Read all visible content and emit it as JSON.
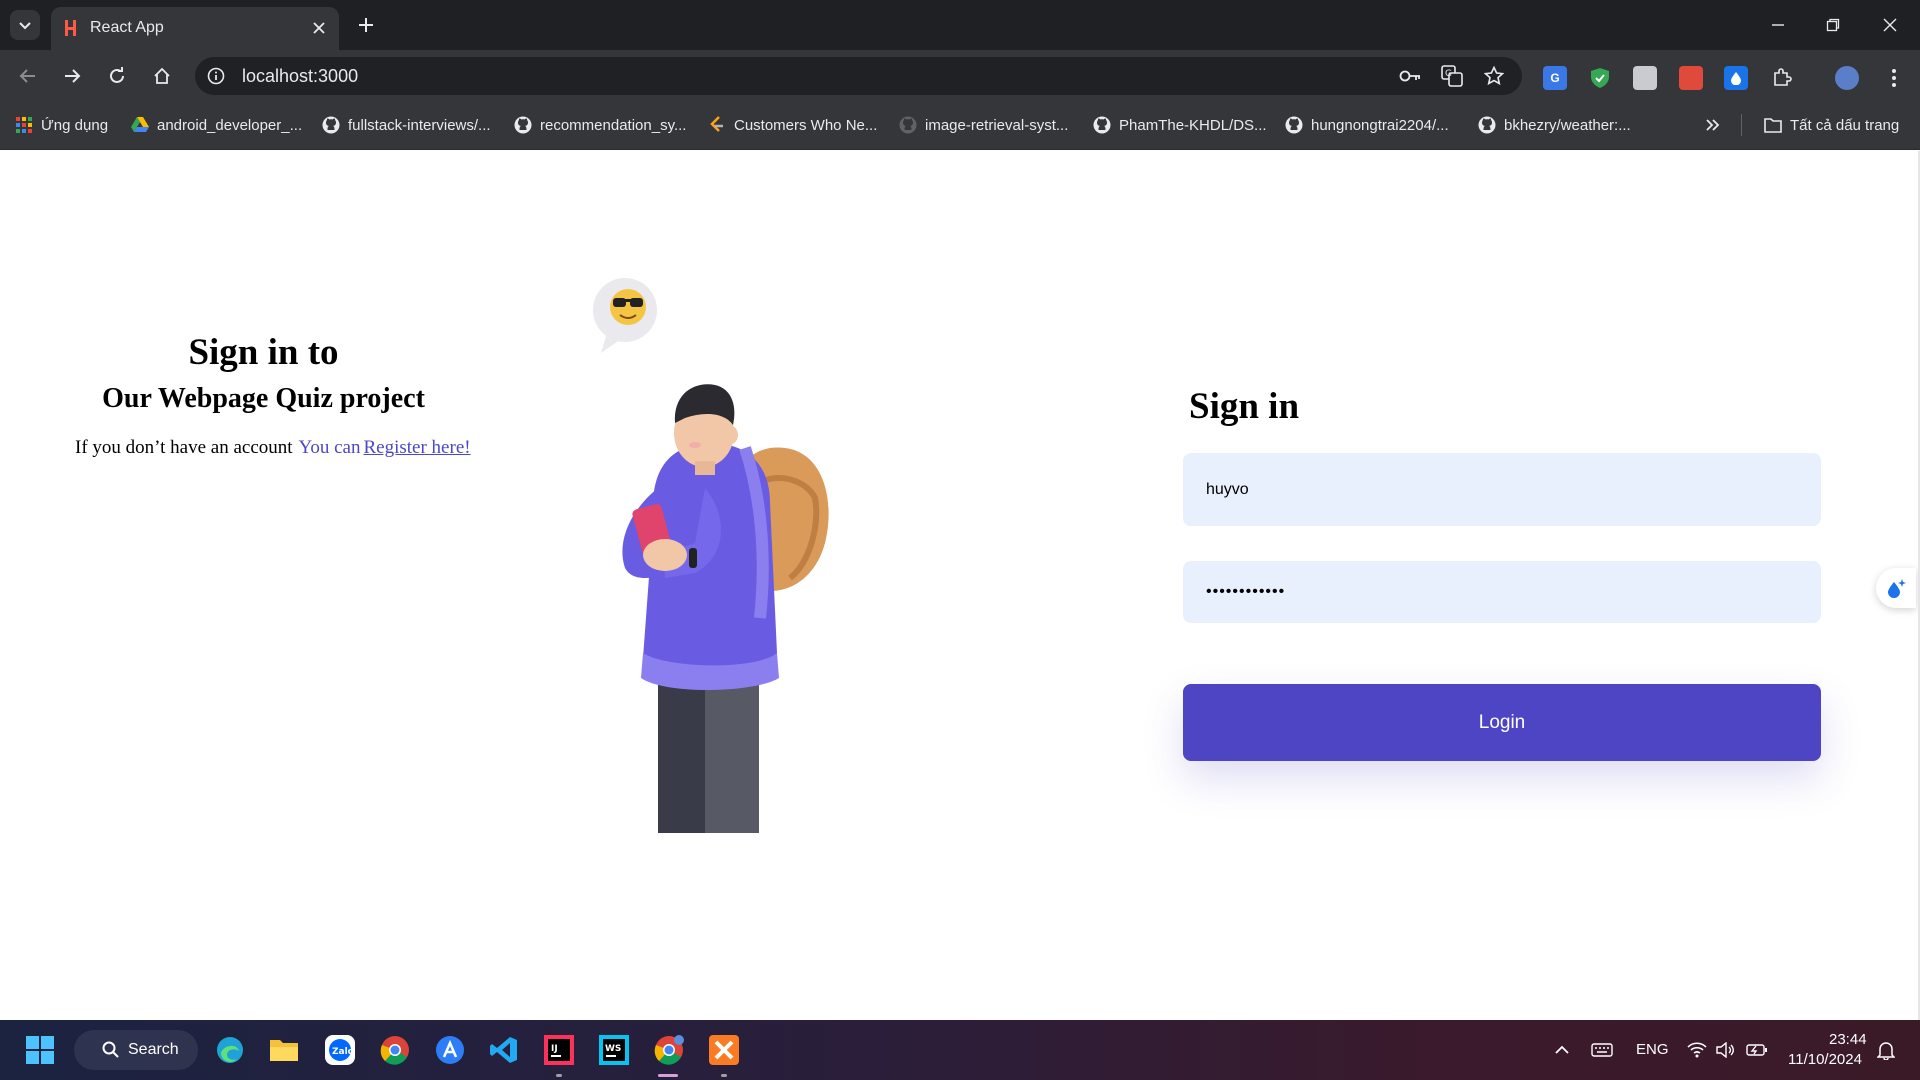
{
  "browser": {
    "tab_title": "React App",
    "url": "localhost:3000",
    "bookmarks": [
      {
        "label": "Ứng dụng",
        "icon": "apps-grid-icon"
      },
      {
        "label": "android_developer_...",
        "icon": "drive-icon"
      },
      {
        "label": "fullstack-interviews/...",
        "icon": "github-icon"
      },
      {
        "label": "recommendation_sy...",
        "icon": "github-icon"
      },
      {
        "label": "Customers Who Ne...",
        "icon": "leetcode-icon"
      },
      {
        "label": "image-retrieval-syst...",
        "icon": "github-icon"
      },
      {
        "label": "PhamThe-KHDL/DS...",
        "icon": "github-icon"
      },
      {
        "label": "hungnongtrai2204/...",
        "icon": "github-icon"
      },
      {
        "label": "bkhezry/weather:...",
        "icon": "github-icon"
      }
    ],
    "all_bookmarks_label": "Tất cả dấu trang"
  },
  "left_panel": {
    "title": "Sign in to",
    "subtitle": "Our Webpage Quiz project",
    "note": "If you don’t have an account",
    "you_can": "You can",
    "register_link": "Register here!"
  },
  "form": {
    "title": "Sign in",
    "username_value": "huyvo",
    "password_value": "••••••••••••",
    "login_label": "Login"
  },
  "colors": {
    "accent": "#4d45c4",
    "input_bg": "#e8f0fe",
    "link": "#4b47c9"
  },
  "taskbar": {
    "search_label": "Search",
    "language": "ENG",
    "time": "23:44",
    "date": "11/10/2024"
  }
}
